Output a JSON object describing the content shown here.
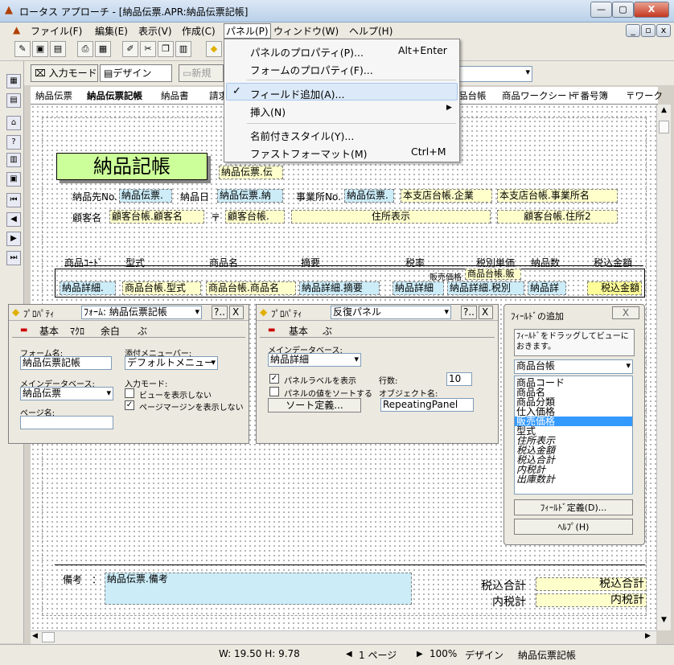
{
  "window": {
    "title": "ロータス アプローチ - [納品伝票.APR:納品伝票記帳]",
    "min": "—",
    "max": "▢",
    "close": "X"
  },
  "mdi": {
    "min": "_",
    "restore": "▫",
    "close": "x"
  },
  "menu": [
    "ファイル(F)",
    "編集(E)",
    "表示(V)",
    "作成(C)",
    "パネル(P)",
    "ウィンドウ(W)",
    "ヘルプ(H)"
  ],
  "dropdown": {
    "items": [
      {
        "label": "パネルのプロパティ(P)...",
        "key": "Alt+Enter"
      },
      {
        "label": "フォームのプロパティ(F)...",
        "key": ""
      },
      {
        "label": "フィールド追加(A)...",
        "key": "",
        "checked": "✓"
      },
      {
        "label": "挿入(N)",
        "key": "▶"
      },
      {
        "label": "名前付きスタイル(Y)...",
        "key": ""
      },
      {
        "label": "ファストフォーマット(M)",
        "key": "Ctrl+M"
      }
    ]
  },
  "toolbar2": {
    "input_mode": "入力モード",
    "design": "デザイン",
    "new": "新規"
  },
  "tabs": [
    "納品伝票",
    "納品伝票記帳",
    "納品書",
    "請求",
    "品台帳",
    "商品ワークシート",
    "〒番号簿",
    "〒ワーク"
  ],
  "form": {
    "title": "納品記帳",
    "title_field": "納品伝票.伝",
    "row1": {
      "lbl1": "納品先No.",
      "f1": "納品伝票.",
      "lbl2": "納品日",
      "f2": "納品伝票.納",
      "lbl3": "事業所No.",
      "f3": "納品伝票.",
      "f4": "本支店台帳.企業",
      "f5": "本支店台帳.事業所名"
    },
    "row2": {
      "lbl1": "顧客名",
      "f1": "顧客台帳.顧客名",
      "lbl2": "〒",
      "f2": "顧客台帳.",
      "f3": "住所表示",
      "f4": "顧客台帳.住所2"
    },
    "headers": [
      "商品ｺｰﾄﾞ",
      "型式",
      "商品名",
      "摘要",
      "税率",
      "税別単価",
      "納品数",
      "税込金額"
    ],
    "small_label": "販売価格",
    "small_field": "商品台帳.販",
    "repeat": [
      "納品詳細.",
      "商品台帳.型式",
      "商品台帳.商品名",
      "納品詳細.摘要",
      "納品詳細",
      "納品詳細.税別",
      "納品詳",
      "税込金額"
    ],
    "memo_label": "備考",
    "memo_field": "納品伝票.備考",
    "total_label": "税込合計",
    "total_field": "税込合計",
    "tax_label": "内税計",
    "tax_field": "内税計"
  },
  "props1": {
    "title": "ﾌﾟﾛﾊﾟﾃｨ",
    "object": "ﾌｫｰﾑ: 納品伝票記帳",
    "help": "?..",
    "close": "X",
    "tabs": [
      "基本",
      "ﾏｸﾛ",
      "余白",
      "ぶ"
    ],
    "form_name_label": "フォーム名:",
    "form_name": "納品伝票記帳",
    "menubar_label": "添付メニューバー:",
    "menubar": "デフォルトメニュー",
    "maindb_label": "メインデータベース:",
    "maindb": "納品伝票",
    "inputmode_label": "入力モード:",
    "opt1": "ビューを表示しない",
    "opt2": "ページマージンを表示しない",
    "opt2_checked": "✓",
    "page_label": "ページ名:",
    "page": ""
  },
  "props2": {
    "title": "ﾌﾟﾛﾊﾟﾃｨ",
    "object": "反復パネル",
    "help": "?..",
    "close": "X",
    "tabs": [
      "基本",
      "ぶ"
    ],
    "maindb_label": "メインデータベース:",
    "maindb": "納品詳細",
    "chk1": "パネルラベルを表示",
    "chk1_checked": "✓",
    "chk2": "パネルの値をソートする",
    "rows_label": "行数:",
    "rows": "10",
    "objname_label": "オブジェクト名:",
    "objname": "RepeatingPanel",
    "sort_btn": "ソート定義..."
  },
  "fieldadd": {
    "title": "ﾌｨｰﾙﾄﾞの追加",
    "close": "X",
    "hint": "ﾌｨｰﾙﾄﾞをドラッグしてビューにおきます。",
    "db": "商品台帳",
    "fields": [
      "商品コード",
      "商品名",
      "商品分類",
      "仕入価格",
      "販売価格",
      "型式",
      "住所表示",
      "税込金額",
      "税込合計",
      "内税計",
      "出庫数計"
    ],
    "selected_index": 4,
    "define_btn": "ﾌｨｰﾙﾄﾞ定義(D)...",
    "help_btn": "ﾍﾙﾌﾟ(H)"
  },
  "status": {
    "size": "W: 19.50 H: 9.78",
    "page": "1 ページ",
    "zoom": "100%",
    "mode": "デザイン",
    "form": "納品伝票記帳"
  }
}
